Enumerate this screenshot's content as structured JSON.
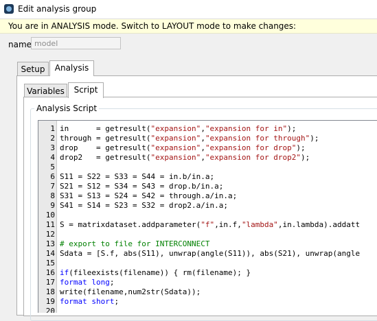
{
  "window": {
    "title": "Edit analysis group",
    "icon": "app-icon"
  },
  "banner": {
    "text": "You are in ANALYSIS mode.  Switch to LAYOUT mode to make changes:"
  },
  "name_field": {
    "label": "name",
    "value": "model"
  },
  "outer_tabs": [
    {
      "label": "Setup"
    },
    {
      "label": "Analysis",
      "active": true
    }
  ],
  "inner_tabs": [
    {
      "label": "Variables"
    },
    {
      "label": "Script",
      "active": true
    }
  ],
  "script_group": {
    "title": "Analysis Script"
  },
  "colors": {
    "string": "#a31515",
    "comment": "#008000",
    "keyword": "#0000ff",
    "banner": "#ffffdc"
  },
  "script": {
    "lines": [
      {
        "n": "1",
        "parts": [
          [
            "in      = getresult(",
            ""
          ],
          [
            "\"expansion\"",
            "s"
          ],
          [
            ",",
            ""
          ],
          [
            "\"expansion for in\"",
            "s"
          ],
          [
            ");",
            ""
          ]
        ]
      },
      {
        "n": "2",
        "parts": [
          [
            "through = getresult(",
            ""
          ],
          [
            "\"expansion\"",
            "s"
          ],
          [
            ",",
            ""
          ],
          [
            "\"expansion for through\"",
            "s"
          ],
          [
            ");",
            ""
          ]
        ]
      },
      {
        "n": "3",
        "parts": [
          [
            "drop    = getresult(",
            ""
          ],
          [
            "\"expansion\"",
            "s"
          ],
          [
            ",",
            ""
          ],
          [
            "\"expansion for drop\"",
            "s"
          ],
          [
            ");",
            ""
          ]
        ]
      },
      {
        "n": "4",
        "parts": [
          [
            "drop2   = getresult(",
            ""
          ],
          [
            "\"expansion\"",
            "s"
          ],
          [
            ",",
            ""
          ],
          [
            "\"expansion for drop2\"",
            "s"
          ],
          [
            ");",
            ""
          ]
        ]
      },
      {
        "n": "5",
        "parts": []
      },
      {
        "n": "6",
        "parts": [
          [
            "S11 = S22 = S33 = S44 = in.b/in.a;",
            ""
          ]
        ]
      },
      {
        "n": "7",
        "parts": [
          [
            "S21 = S12 = S34 = S43 = drop.b/in.a;",
            ""
          ]
        ]
      },
      {
        "n": "8",
        "parts": [
          [
            "S31 = S13 = S24 = S42 = through.a/in.a;",
            ""
          ]
        ]
      },
      {
        "n": "9",
        "parts": [
          [
            "S41 = S14 = S23 = S32 = drop2.a/in.a;",
            ""
          ]
        ]
      },
      {
        "n": "10",
        "parts": []
      },
      {
        "n": "11",
        "parts": [
          [
            "S = matrixdataset.addparameter(",
            ""
          ],
          [
            "\"f\"",
            "s"
          ],
          [
            ",in.f,",
            ""
          ],
          [
            "\"lambda\"",
            "s"
          ],
          [
            ",in.lambda).addatt",
            ""
          ]
        ]
      },
      {
        "n": "12",
        "parts": []
      },
      {
        "n": "13",
        "parts": [
          [
            "# export to file for INTERCONNECT",
            "c"
          ]
        ]
      },
      {
        "n": "14",
        "parts": [
          [
            "Sdata = [S.f, abs(S11), unwrap(angle(S11)), abs(S21), unwrap(angle",
            ""
          ]
        ]
      },
      {
        "n": "15",
        "parts": []
      },
      {
        "n": "16",
        "parts": [
          [
            "if",
            "k"
          ],
          [
            "(fileexists(filename)) { rm(filename); }",
            ""
          ]
        ]
      },
      {
        "n": "17",
        "parts": [
          [
            "format long",
            "k"
          ],
          [
            ";",
            ""
          ]
        ]
      },
      {
        "n": "18",
        "parts": [
          [
            "write(filename,num2str(Sdata));",
            ""
          ]
        ]
      },
      {
        "n": "19",
        "parts": [
          [
            "format short",
            "k"
          ],
          [
            ";",
            ""
          ]
        ]
      },
      {
        "n": "20",
        "parts": []
      }
    ]
  }
}
